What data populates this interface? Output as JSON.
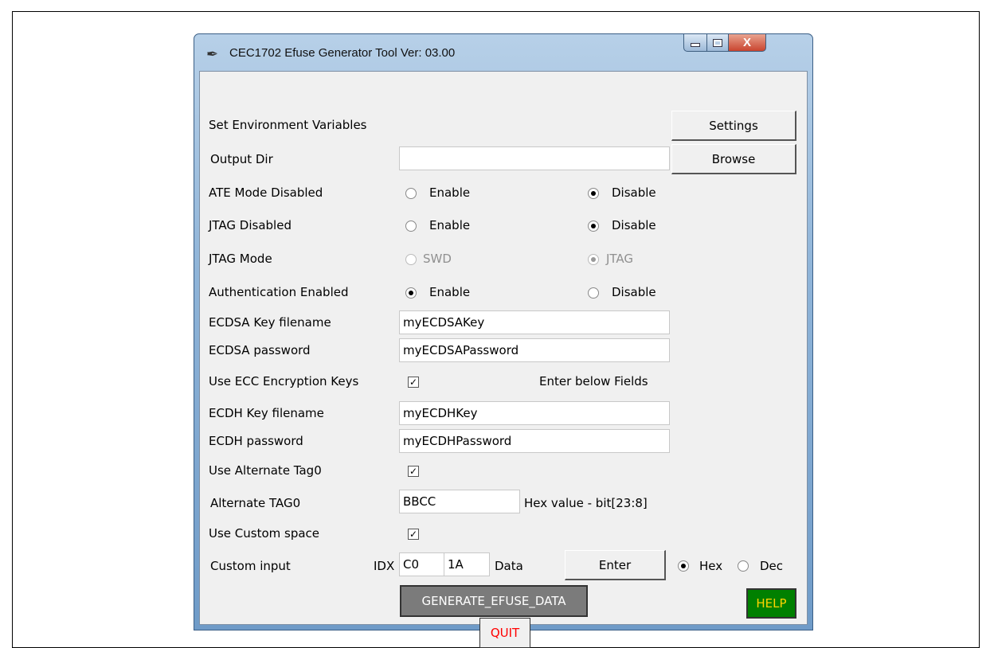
{
  "window": {
    "title": "CEC1702 Efuse Generator Tool Ver: 03.00",
    "close_glyph": "X"
  },
  "rows": {
    "env": {
      "label": "Set Environment Variables",
      "button": "Settings"
    },
    "output_dir": {
      "label": "Output Dir",
      "value": "",
      "button": "Browse"
    },
    "ate_mode": {
      "label": "ATE Mode Disabled",
      "opt1": "Enable",
      "opt2": "Disable",
      "selected": "Disable"
    },
    "jtag": {
      "label": "JTAG Disabled",
      "opt1": "Enable",
      "opt2": "Disable",
      "selected": "Disable"
    },
    "jtag_mode": {
      "label": "JTAG Mode",
      "opt1": "SWD",
      "opt2": "JTAG",
      "selected": "JTAG"
    },
    "auth": {
      "label": "Authentication Enabled",
      "opt1": "Enable",
      "opt2": "Disable",
      "selected": "Enable"
    },
    "ecdsa_key": {
      "label": "ECDSA Key filename",
      "value": "myECDSAKey"
    },
    "ecdsa_pw": {
      "label": "ECDSA password",
      "value": "myECDSAPassword"
    },
    "ecc": {
      "label": "Use ECC Encryption Keys",
      "note": "Enter below Fields"
    },
    "ecdh_key": {
      "label": "ECDH Key filename",
      "value": "myECDHKey"
    },
    "ecdh_pw": {
      "label": "ECDH password",
      "value": "myECDHPassword"
    },
    "alt_tag_use": {
      "label": "Use Alternate Tag0"
    },
    "alt_tag": {
      "label": "Alternate TAG0",
      "value": "BBCC",
      "note": "Hex value - bit[23:8]"
    },
    "custom_space": {
      "label": "Use Custom space"
    },
    "custom_input": {
      "label": "Custom input",
      "idx_label": "IDX",
      "idx_value": "C0",
      "data_value": "1A",
      "data_label": "Data",
      "button": "Enter",
      "opt1": "Hex",
      "opt2": "Dec",
      "selected": "Hex"
    }
  },
  "actions": {
    "generate": "GENERATE_EFUSE_DATA",
    "help": "HELP",
    "quit": "QUIT"
  },
  "colors": {
    "generate_bg": "#7b7b7b",
    "help_bg": "#008000",
    "help_text": "#ffd400",
    "quit_text": "#ff0000"
  }
}
